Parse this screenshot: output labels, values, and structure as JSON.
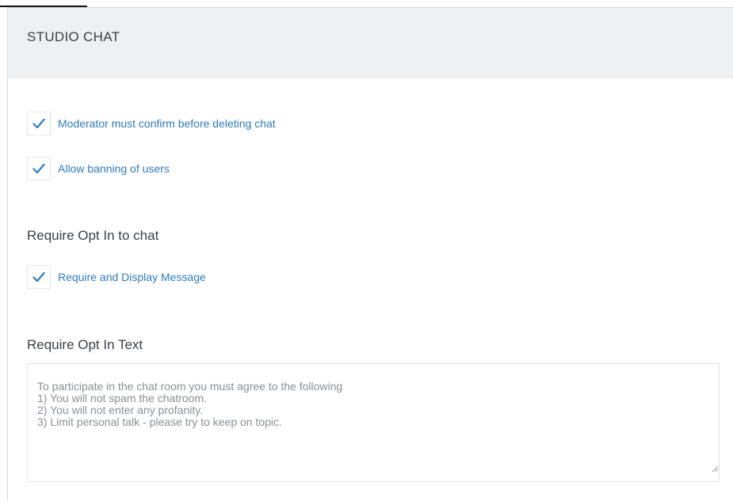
{
  "panel": {
    "title": "STUDIO CHAT"
  },
  "options": {
    "confirm_delete": {
      "label": "Moderator must confirm before deleting chat",
      "checked": true
    },
    "allow_banning": {
      "label": "Allow banning of users",
      "checked": true
    }
  },
  "opt_in": {
    "heading": "Require Opt In to chat",
    "display_message": {
      "label": "Require and Display Message",
      "checked": true
    }
  },
  "opt_in_text": {
    "heading": "Require Opt In Text",
    "value": "To participate in the chat room you must agree to the following\n1) You will not spam the chatroom.\n2) You will not enter any profanity.\n3) Limit personal talk - please try to keep on topic."
  },
  "colors": {
    "accent": "#2f7bbf",
    "header_bg": "#eef1f4",
    "text": "#3a3f45"
  },
  "icons": {
    "check": "checkmark-icon",
    "resize": "resize-grip-icon"
  }
}
